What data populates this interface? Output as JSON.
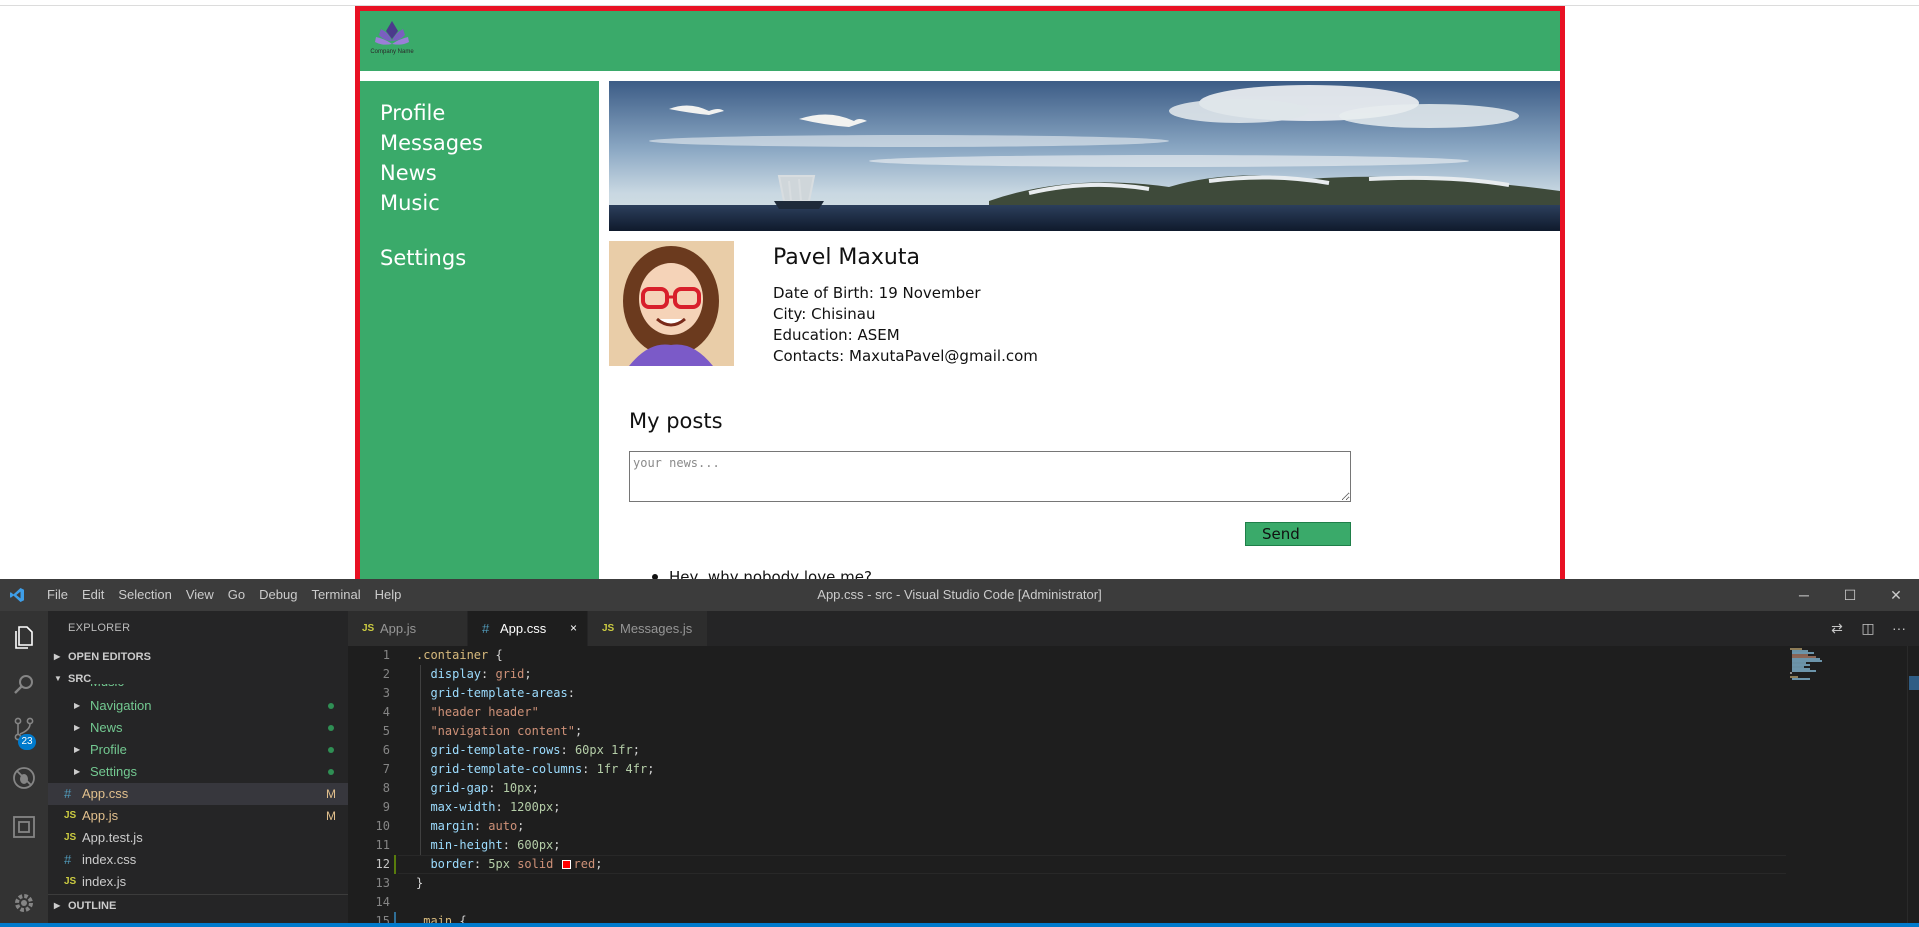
{
  "site": {
    "logo_text": "Company Name",
    "nav": {
      "profile": "Profile",
      "messages": "Messages",
      "news": "News",
      "music": "Music",
      "settings": "Settings"
    },
    "profile": {
      "name": "Pavel Maxuta",
      "birth": "Date of Birth: 19 November",
      "city": "City: Chisinau",
      "education": "Education: ASEM",
      "contacts": "Contacts: MaxutaPavel@gmail.com"
    },
    "posts": {
      "title": "My posts",
      "placeholder": "your news...",
      "send_label": "Send",
      "items": [
        "Hey, why nobody love me?"
      ]
    },
    "colors": {
      "header": "#3aaa6a",
      "border": "#e81123"
    }
  },
  "vscode": {
    "window_title": "App.css - src - Visual Studio Code [Administrator]",
    "menu": [
      "File",
      "Edit",
      "Selection",
      "View",
      "Go",
      "Debug",
      "Terminal",
      "Help"
    ],
    "window_buttons": {
      "minimize": "─",
      "maximize": "☐",
      "close": "✕"
    },
    "activity": {
      "scm_badge": "23"
    },
    "explorer": {
      "title": "EXPLORER",
      "open_editors": "OPEN EDITORS",
      "src": "SRC",
      "outline": "OUTLINE",
      "partial_top": "Music",
      "folders": [
        "Navigation",
        "News",
        "Profile",
        "Settings"
      ],
      "files": [
        {
          "name": "App.css",
          "type": "css",
          "status": "M"
        },
        {
          "name": "App.js",
          "type": "js",
          "status": "M"
        },
        {
          "name": "App.test.js",
          "type": "js",
          "status": ""
        },
        {
          "name": "index.css",
          "type": "css",
          "status": ""
        },
        {
          "name": "index.js",
          "type": "js",
          "status": ""
        }
      ]
    },
    "tabs": [
      {
        "label": "App.js",
        "icon": "JS"
      },
      {
        "label": "App.css",
        "icon": "#"
      },
      {
        "label": "Messages.js",
        "icon": "JS"
      }
    ],
    "tab_close": "×",
    "editor_actions": {
      "compare": "⇄",
      "split": "◫",
      "more": "···"
    },
    "line_numbers": [
      "1",
      "2",
      "3",
      "4",
      "5",
      "6",
      "7",
      "8",
      "9",
      "10",
      "11",
      "12",
      "13",
      "14",
      "15"
    ],
    "code": {
      "l1_sel": ".container",
      "l1_brace": " {",
      "l2_prop": "display",
      "l2_val": "grid",
      "l3_prop": "grid-template-areas",
      "l4_val": "\"header header\"",
      "l5_val": "\"navigation content\"",
      "l6_prop": "grid-template-rows",
      "l6_val": "60px 1fr",
      "l7_prop": "grid-template-columns",
      "l7_val": "1fr 4fr",
      "l8_prop": "grid-gap",
      "l8_val": "10px",
      "l9_prop": "max-width",
      "l9_val": "1200px",
      "l10_prop": "margin",
      "l10_val": "auto",
      "l11_prop": "min-height",
      "l11_val": "600px",
      "l12_prop": "border",
      "l12_num": "5px",
      "l12_kw": "solid",
      "l12_color": "red",
      "l13": "}",
      "l15_sel": ".main",
      "l15_brace": " {"
    },
    "colors": {
      "status": "#007acc",
      "red_swatch": "#ff0000"
    }
  }
}
